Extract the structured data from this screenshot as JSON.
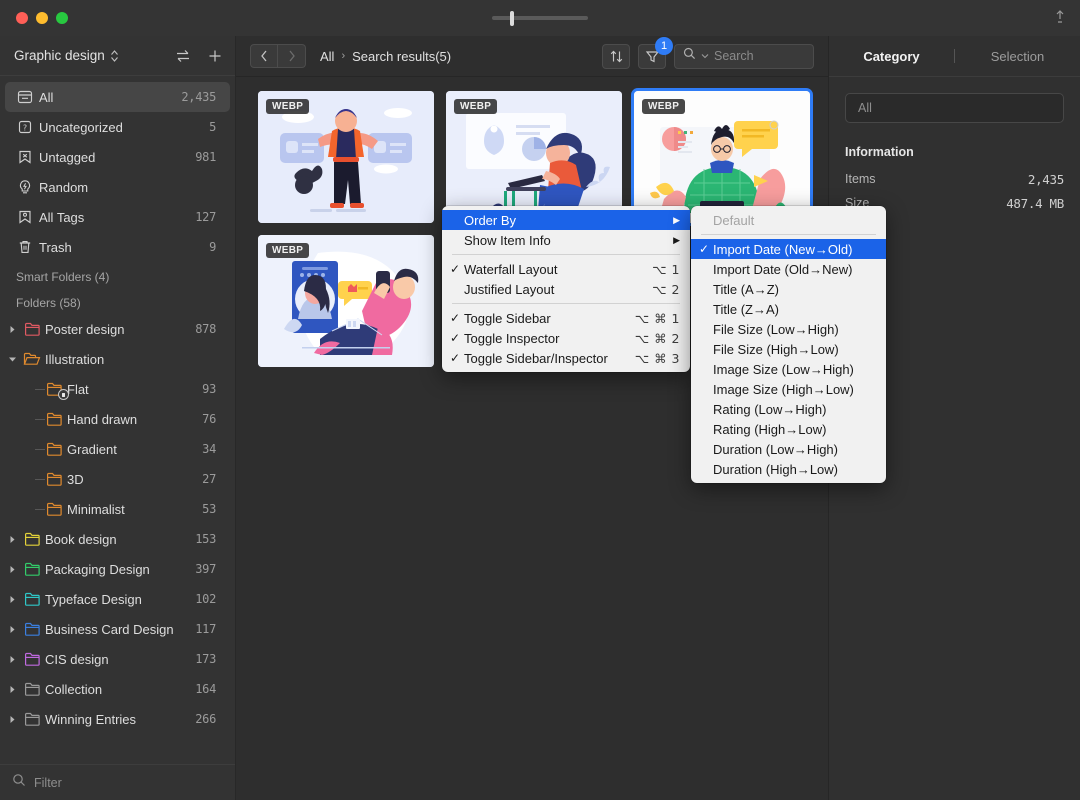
{
  "window": {
    "traffic_lights": [
      "close",
      "minimize",
      "zoom"
    ],
    "pin_icon": "pin-icon",
    "zoom_slider_value": 20
  },
  "sidebar": {
    "library_title": "Graphic design",
    "header_icons": [
      "swap-icon",
      "plus-icon"
    ],
    "items": [
      {
        "label": "All",
        "count": "2,435",
        "icon": "archive-icon",
        "active": true
      },
      {
        "label": "Uncategorized",
        "count": "5",
        "icon": "question-box-icon",
        "active": false
      },
      {
        "label": "Untagged",
        "count": "981",
        "icon": "untagged-icon",
        "active": false
      },
      {
        "label": "Random",
        "count": "",
        "icon": "bulb-icon",
        "active": false
      },
      {
        "label": "All Tags",
        "count": "127",
        "icon": "tag-bookmark-icon",
        "active": false
      },
      {
        "label": "Trash",
        "count": "9",
        "icon": "trash-icon",
        "active": false
      }
    ],
    "smart_folders_header": "Smart Folders (4)",
    "folders_header": "Folders (58)",
    "folders": [
      {
        "label": "Poster design",
        "count": "878",
        "color": "#e05a63",
        "level": 0,
        "twisty": "collapsed",
        "locked": false
      },
      {
        "label": "Illustration",
        "count": "",
        "color": "#e08a2e",
        "level": 0,
        "twisty": "expanded",
        "locked": false
      },
      {
        "label": "Flat",
        "count": "93",
        "color": "#e08a2e",
        "level": 1,
        "twisty": "none",
        "locked": true
      },
      {
        "label": "Hand drawn",
        "count": "76",
        "color": "#e08a2e",
        "level": 1,
        "twisty": "none",
        "locked": false
      },
      {
        "label": "Gradient",
        "count": "34",
        "color": "#e08a2e",
        "level": 1,
        "twisty": "none",
        "locked": false
      },
      {
        "label": "3D",
        "count": "27",
        "color": "#e08a2e",
        "level": 1,
        "twisty": "none",
        "locked": false
      },
      {
        "label": "Minimalist",
        "count": "53",
        "color": "#e08a2e",
        "level": 1,
        "twisty": "none",
        "locked": false
      },
      {
        "label": "Book design",
        "count": "153",
        "color": "#e3d23a",
        "level": 0,
        "twisty": "collapsed",
        "locked": false
      },
      {
        "label": "Packaging Design",
        "count": "397",
        "color": "#33cc6a",
        "level": 0,
        "twisty": "collapsed",
        "locked": false
      },
      {
        "label": "Typeface Design",
        "count": "102",
        "color": "#2fc8c8",
        "level": 0,
        "twisty": "collapsed",
        "locked": false
      },
      {
        "label": "Business Card Design",
        "count": "117",
        "color": "#3b7fe0",
        "level": 0,
        "twisty": "collapsed",
        "locked": false
      },
      {
        "label": "CIS design",
        "count": "173",
        "color": "#c06ae0",
        "level": 0,
        "twisty": "collapsed",
        "locked": false
      },
      {
        "label": "Collection",
        "count": "164",
        "color": "#9a9a9a",
        "level": 0,
        "twisty": "collapsed",
        "locked": false
      },
      {
        "label": "Winning Entries",
        "count": "266",
        "color": "#9a9a9a",
        "level": 0,
        "twisty": "collapsed",
        "locked": false
      }
    ],
    "filter_placeholder": "Filter",
    "filter_icon": "search-icon"
  },
  "toolbar": {
    "back_icon": "chevron-left-icon",
    "forward_icon": "chevron-right-icon",
    "breadcrumb": {
      "root": "All",
      "separator": "›",
      "current": "Search results(5)"
    },
    "sort_icon": "sort-arrows-icon",
    "filter_icon": "funnel-icon",
    "filter_badge": "1",
    "search_icon": "search-icon",
    "search_placeholder": "Search",
    "search_value": ""
  },
  "grid": {
    "items": [
      {
        "format": "WEBP",
        "alt": "man-with-cat-illustration",
        "selected": false
      },
      {
        "format": "WEBP",
        "alt": "woman-working-on-laptop-illustration",
        "selected": false
      },
      {
        "format": "WEBP",
        "alt": "man-with-chat-bubble-illustration",
        "selected": true
      },
      {
        "format": "WEBP",
        "alt": "man-on-phone-illustration",
        "selected": false
      }
    ]
  },
  "inspector": {
    "tabs": [
      {
        "label": "Category",
        "active": true
      },
      {
        "label": "Selection",
        "active": false
      }
    ],
    "scope_value": "All",
    "information_header": "Information",
    "rows": [
      {
        "key": "Items",
        "value": "2,435"
      },
      {
        "key": "Size",
        "value": "487.4 MB"
      }
    ]
  },
  "context_menu": {
    "items": [
      {
        "label": "Order By",
        "checked": false,
        "shortcut": "",
        "submenu": true,
        "highlighted": true
      },
      {
        "label": "Show Item Info",
        "checked": false,
        "shortcut": "",
        "submenu": true,
        "highlighted": false
      },
      {
        "separator": true
      },
      {
        "label": "Waterfall Layout",
        "checked": true,
        "shortcut": "⌥ 1",
        "submenu": false,
        "highlighted": false
      },
      {
        "label": "Justified Layout",
        "checked": false,
        "shortcut": "⌥ 2",
        "submenu": false,
        "highlighted": false
      },
      {
        "separator": true
      },
      {
        "label": "Toggle Sidebar",
        "checked": true,
        "shortcut": "⌥ ⌘ 1",
        "submenu": false,
        "highlighted": false
      },
      {
        "label": "Toggle Inspector",
        "checked": true,
        "shortcut": "⌥ ⌘ 2",
        "submenu": false,
        "highlighted": false
      },
      {
        "label": "Toggle Sidebar/Inspector",
        "checked": true,
        "shortcut": "⌥ ⌘ 3",
        "submenu": false,
        "highlighted": false
      }
    ]
  },
  "order_by_submenu": {
    "items": [
      {
        "label": "Default",
        "checked": false,
        "disabled": true,
        "highlighted": false
      },
      {
        "separator": true
      },
      {
        "label": "Import Date (New→Old)",
        "checked": true,
        "disabled": false,
        "highlighted": true
      },
      {
        "label": "Import Date (Old→New)",
        "checked": false,
        "disabled": false,
        "highlighted": false
      },
      {
        "label": "Title (A→Z)",
        "checked": false,
        "disabled": false,
        "highlighted": false
      },
      {
        "label": "Title (Z→A)",
        "checked": false,
        "disabled": false,
        "highlighted": false
      },
      {
        "label": "File Size (Low→High)",
        "checked": false,
        "disabled": false,
        "highlighted": false
      },
      {
        "label": "File Size (High→Low)",
        "checked": false,
        "disabled": false,
        "highlighted": false
      },
      {
        "label": "Image Size (Low→High)",
        "checked": false,
        "disabled": false,
        "highlighted": false
      },
      {
        "label": "Image Size (High→Low)",
        "checked": false,
        "disabled": false,
        "highlighted": false
      },
      {
        "label": "Rating (Low→High)",
        "checked": false,
        "disabled": false,
        "highlighted": false
      },
      {
        "label": "Rating (High→Low)",
        "checked": false,
        "disabled": false,
        "highlighted": false
      },
      {
        "label": "Duration (Low→High)",
        "checked": false,
        "disabled": false,
        "highlighted": false
      },
      {
        "label": "Duration (High→Low)",
        "checked": false,
        "disabled": false,
        "highlighted": false
      }
    ]
  },
  "colors": {
    "accent": "#2f7cf6",
    "menu_highlight": "#1b63e8",
    "sidebar_bg": "#333333",
    "content_bg": "#2e2e2e"
  }
}
